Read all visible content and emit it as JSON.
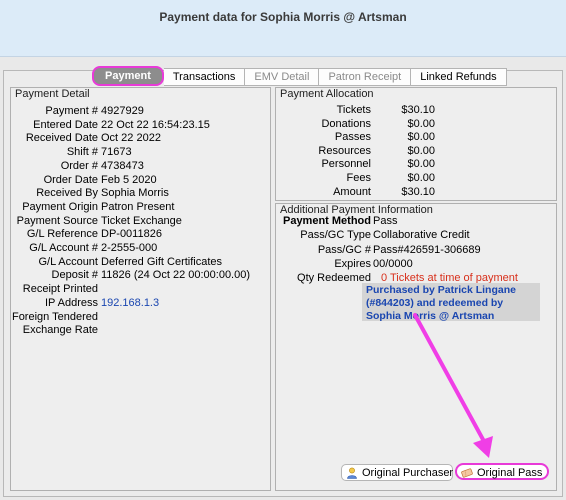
{
  "window": {
    "title": "Payment data for Sophia Morris @ Artsman"
  },
  "tabs": [
    {
      "label": "Payment",
      "state": "selected"
    },
    {
      "label": "Transactions",
      "state": "enabled"
    },
    {
      "label": "EMV Detail",
      "state": "disabled"
    },
    {
      "label": "Patron Receipt",
      "state": "disabled"
    },
    {
      "label": "Linked Refunds",
      "state": "enabled"
    }
  ],
  "payment_detail": {
    "title": "Payment Detail",
    "rows": [
      {
        "label": "Payment #",
        "value": "4927929"
      },
      {
        "label": "Entered Date",
        "value": "22 Oct 22  16:54:23.15"
      },
      {
        "label": "Received Date",
        "value": "Oct 22 2022"
      },
      {
        "label": "Shift #",
        "value": "71673"
      },
      {
        "label": "Order #",
        "value": "4738473"
      },
      {
        "label": "Order Date",
        "value": "Feb 5 2020"
      },
      {
        "label": "Received By",
        "value": "Sophia Morris"
      },
      {
        "label": "Payment Origin",
        "value": "Patron Present"
      },
      {
        "label": "Payment Source",
        "value": "Ticket Exchange"
      },
      {
        "label": "G/L Reference",
        "value": "DP-0011826"
      },
      {
        "label": "G/L Account #",
        "value": "2-2555-000"
      },
      {
        "label": "G/L Account",
        "value": "Deferred Gift Certificates"
      },
      {
        "label": "Deposit #",
        "value": "11826  (24 Oct 22  00:00:00.00)"
      },
      {
        "label": "Receipt Printed",
        "value": ""
      },
      {
        "label": "IP Address",
        "value": "192.168.1.3"
      },
      {
        "label": "Foreign Tendered",
        "value": ""
      },
      {
        "label": "Exchange Rate",
        "value": ""
      }
    ]
  },
  "payment_allocation": {
    "title": "Payment Allocation",
    "rows": [
      {
        "label": "Tickets",
        "value": "$30.10"
      },
      {
        "label": "Donations",
        "value": "$0.00"
      },
      {
        "label": "Passes",
        "value": "$0.00"
      },
      {
        "label": "Resources",
        "value": "$0.00"
      },
      {
        "label": "Personnel",
        "value": "$0.00"
      },
      {
        "label": "Fees",
        "value": "$0.00"
      },
      {
        "label": "Amount",
        "value": "$30.10"
      }
    ]
  },
  "additional_info": {
    "title": "Additional Payment Information",
    "rows": [
      {
        "label": "Payment Method",
        "value": "Pass"
      },
      {
        "label": "Pass/GC Type",
        "value": "Collaborative Credit"
      },
      {
        "label": "Pass/GC #",
        "value": "Pass#426591-306689"
      },
      {
        "label": "Expires",
        "value": "00/0000"
      },
      {
        "label": "Qty Redeemed",
        "value": "0 Tickets at time of payment"
      }
    ],
    "note": "Purchased by Patrick Lingane (#844203) and redeemed by Sophia Morris @ Artsman"
  },
  "buttons": {
    "original_purchaser": "Original Purchaser",
    "original_pass": "Original Pass"
  },
  "colors": {
    "highlight": "#e83ad8",
    "link": "#1a46b0",
    "warning": "#d8301c"
  }
}
